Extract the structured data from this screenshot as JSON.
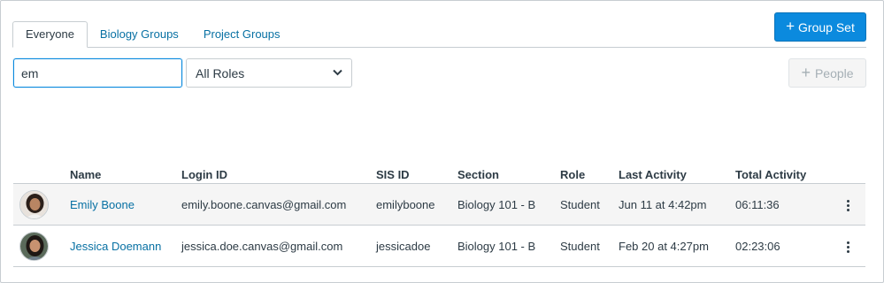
{
  "tabs": [
    {
      "label": "Everyone",
      "active": true
    },
    {
      "label": "Biology Groups",
      "active": false
    },
    {
      "label": "Project Groups",
      "active": false
    }
  ],
  "group_set_button": {
    "label": "Group Set",
    "icon": "plus-icon"
  },
  "search": {
    "value": "em"
  },
  "role_filter": {
    "selected": "All Roles"
  },
  "people_button": {
    "label": "People",
    "icon": "plus-icon",
    "disabled": true
  },
  "table": {
    "headers": {
      "name": "Name",
      "login_id": "Login ID",
      "sis_id": "SIS ID",
      "section": "Section",
      "role": "Role",
      "last_activity": "Last Activity",
      "total_activity": "Total Activity"
    },
    "rows": [
      {
        "name": "Emily Boone",
        "login_id": "emily.boone.canvas@gmail.com",
        "sis_id": "emilyboone",
        "section": "Biology 101 - B",
        "role": "Student",
        "last_activity": "Jun 11 at 4:42pm",
        "total_activity": "06:11:36"
      },
      {
        "name": "Jessica Doemann",
        "login_id": "jessica.doe.canvas@gmail.com",
        "sis_id": "jessicadoe",
        "section": "Biology 101 - B",
        "role": "Student",
        "last_activity": "Feb 20 at 4:27pm",
        "total_activity": "02:23:06"
      }
    ]
  },
  "colors": {
    "primary": "#0b8ade",
    "link": "#0770a3",
    "text": "#2d3b45",
    "border": "#c7cdd1"
  }
}
